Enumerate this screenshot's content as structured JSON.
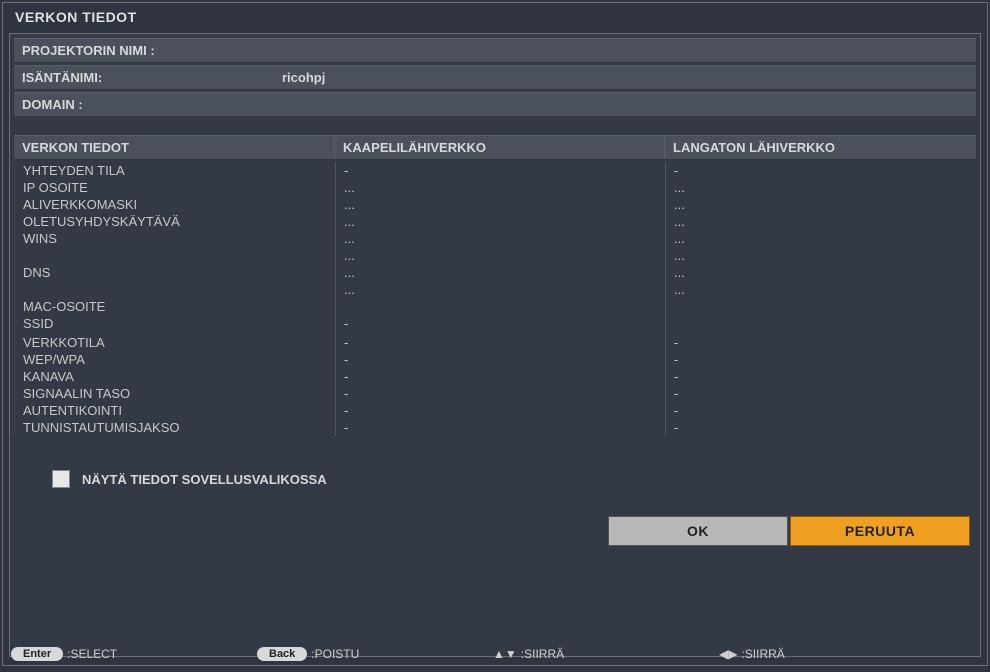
{
  "title": "VERKON TIEDOT",
  "info": {
    "projector_name_label": "PROJEKTORIN NIMI :",
    "projector_name_value": "",
    "host_label": "ISÄNTÄNIMI:",
    "host_value": "ricohpj",
    "domain_label": "DOMAIN :",
    "domain_value": ""
  },
  "table": {
    "headers": {
      "left": "VERKON TIEDOT",
      "mid": "KAAPELILÄHIVERKKO",
      "right": "LANGATON LÄHIVERKKO"
    },
    "rows": [
      {
        "left": "YHTEYDEN TILA",
        "mid": "-",
        "right": "-"
      },
      {
        "left": "IP OSOITE",
        "mid": "...",
        "right": "..."
      },
      {
        "left": "ALIVERKKOMASKI",
        "mid": "...",
        "right": "..."
      },
      {
        "left": "OLETUSYHDYSKÄYTÄVÄ",
        "mid": "...",
        "right": "..."
      },
      {
        "left": "WINS",
        "mid": "...",
        "right": "..."
      },
      {
        "left": "",
        "mid": "...",
        "right": "..."
      },
      {
        "left": "DNS",
        "mid": "...",
        "right": "..."
      },
      {
        "left": "",
        "mid": "...",
        "right": "..."
      },
      {
        "left": "MAC-OSOITE",
        "mid": "",
        "right": ""
      },
      {
        "left": "SSID",
        "mid": "-",
        "right": ""
      },
      {
        "left": "",
        "mid": "",
        "right": ""
      },
      {
        "left": "VERKKOTILA",
        "mid": "-",
        "right": "-"
      },
      {
        "left": "WEP/WPA",
        "mid": "-",
        "right": "-"
      },
      {
        "left": "KANAVA",
        "mid": "-",
        "right": "-"
      },
      {
        "left": "SIGNAALIN TASO",
        "mid": "-",
        "right": "-"
      },
      {
        "left": "AUTENTIKOINTI",
        "mid": "-",
        "right": "-"
      },
      {
        "left": "TUNNISTAUTUMISJAKSO",
        "mid": "-",
        "right": "-"
      }
    ]
  },
  "checkbox": {
    "label": "NÄYTÄ TIEDOT SOVELLUSVALIKOSSA",
    "checked": false
  },
  "buttons": {
    "ok": "OK",
    "cancel": "PERUUTA"
  },
  "footer": {
    "enter_pill": "Enter",
    "enter_label": ":SELECT",
    "back_pill": "Back",
    "back_label": ":POISTU",
    "updown_icon": "▲▼",
    "move1": ":SIIRRÄ",
    "leftright_icon": "◀▶",
    "move2": ":SIIRRÄ"
  }
}
